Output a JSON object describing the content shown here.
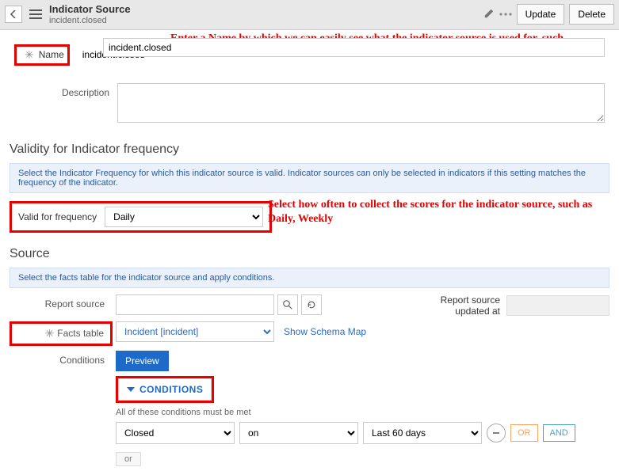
{
  "header": {
    "title": "Indicator Source",
    "subtitle": "incident.closed",
    "update_label": "Update",
    "delete_label": "Delete"
  },
  "form": {
    "name_label": "Name",
    "name_value": "incident.closed",
    "desc_label": "Description"
  },
  "annotations": {
    "name": "Enter a Name by which we can easily see what the indicator source is used for, such as Incident.closed",
    "frequency": "Select how often to collect the scores for the indicator source, such as Daily, Weekly"
  },
  "validity": {
    "section_title": "Validity for Indicator frequency",
    "info": "Select the Indicator Frequency for which this indicator source is valid. Indicator sources can only be selected in indicators if this setting matches the frequency of the indicator.",
    "label": "Valid for frequency",
    "value": "Daily"
  },
  "source": {
    "section_title": "Source",
    "info": "Select the facts table for the indicator source and apply conditions.",
    "report_source_label": "Report source",
    "report_updated_label": "Report source updated at",
    "facts_label": "Facts table",
    "facts_value": "Incident [incident]",
    "schema_link": "Show Schema Map",
    "conditions_label": "Conditions",
    "preview_label": "Preview",
    "conditions_toggle": "CONDITIONS",
    "conditions_msg": "All of these conditions must be met",
    "cond_field": "Closed",
    "cond_op": "on",
    "cond_val": "Last 60 days",
    "or_label": "OR",
    "and_label": "AND",
    "or_sep": "or"
  }
}
